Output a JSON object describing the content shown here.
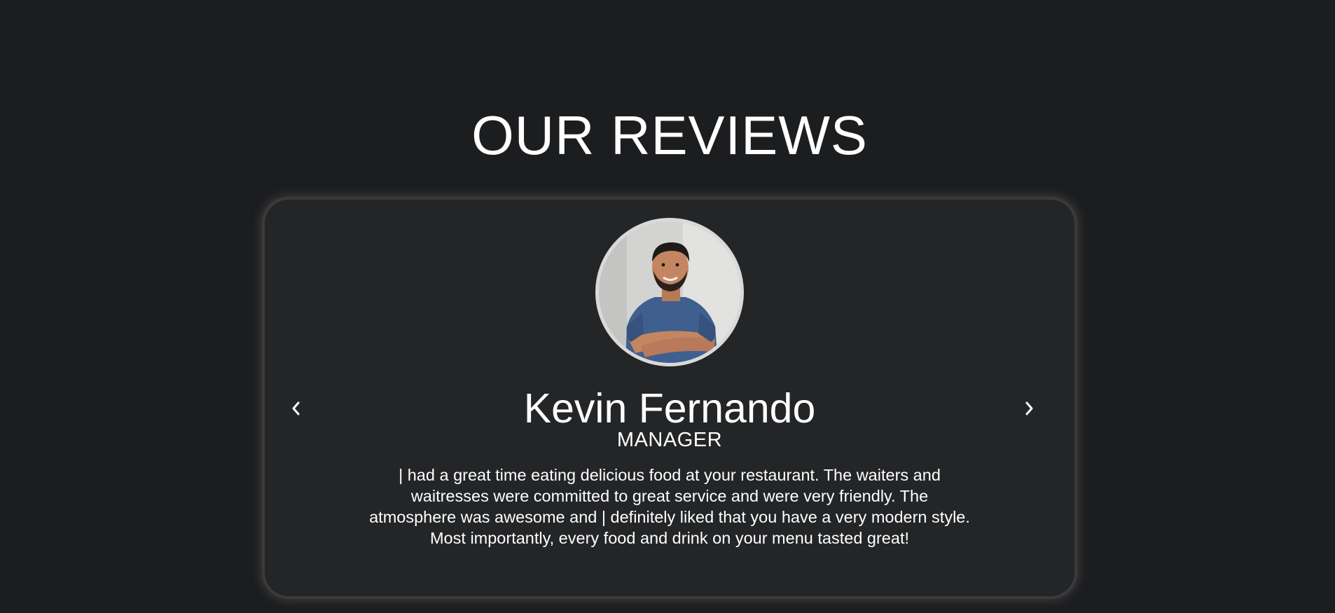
{
  "section": {
    "title": "OUR REVIEWS"
  },
  "review": {
    "name": "Kevin Fernando",
    "role": "MANAGER",
    "text": "| had a great time eating delicious food at your restaurant. The waiters and waitresses were committed to great service and were very friendly. The atmosphere was awesome and | definitely liked that you have a very modern style. Most importantly, every food and drink on your menu tasted great!",
    "avatar_alt": "Reviewer photo"
  },
  "navigation": {
    "prev_icon": "chevron-left-icon",
    "next_icon": "chevron-right-icon"
  },
  "colors": {
    "page_background": "#1c1d1f",
    "card_background": "#242527",
    "card_border": "#3b3a3a",
    "text": "#ffffff",
    "avatar_ring": "#d9d9d9"
  }
}
